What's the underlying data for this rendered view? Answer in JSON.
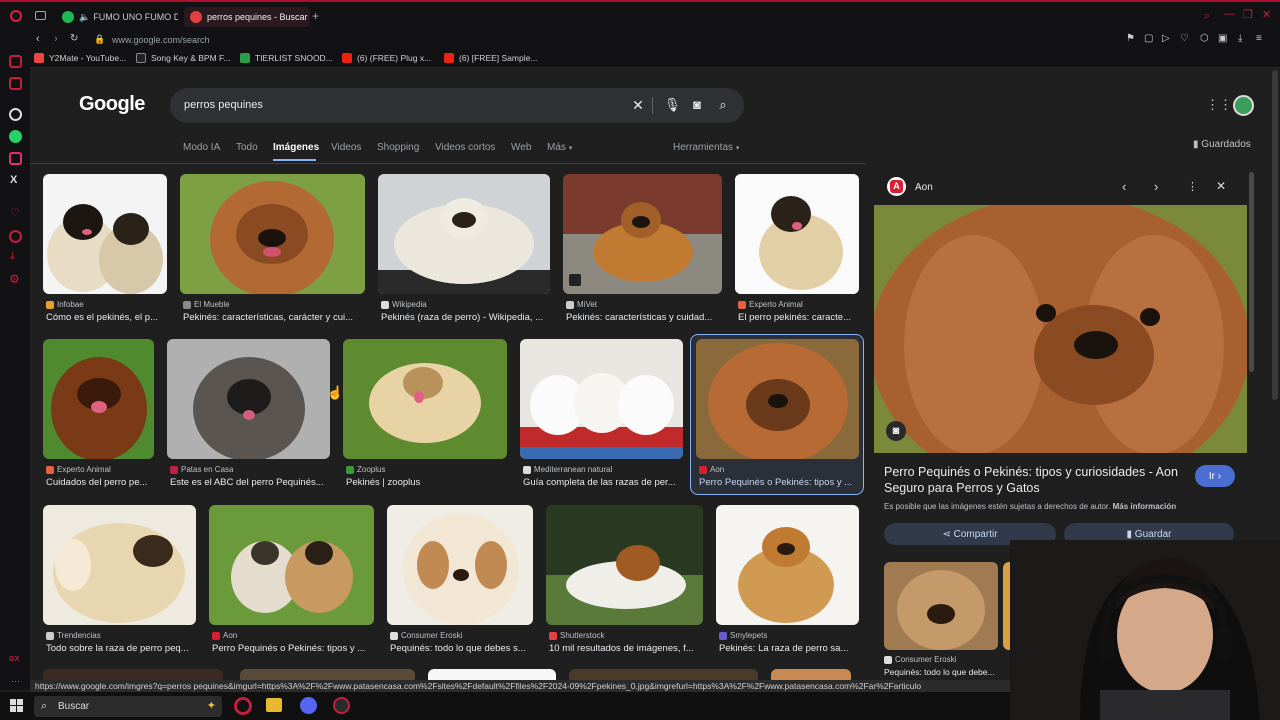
{
  "tabs": [
    {
      "label": "FUMO UNO FUMO DO"
    },
    {
      "label": "perros pequines - Buscar"
    }
  ],
  "address": {
    "url": "www.google.com/search"
  },
  "bookmarks": [
    "Y2Mate - YouTube...",
    "Song Key & BPM F...",
    "TIERLIST SNOOD...",
    "(6) (FREE) Plug x...",
    "(6) [FREE] Sample..."
  ],
  "google": {
    "logo": "Google",
    "query": "perros pequines",
    "saved": "Guardados"
  },
  "nav": [
    "Modo IA",
    "Todo",
    "Imágenes",
    "Videos",
    "Shopping",
    "Videos cortos",
    "Web",
    "Más",
    "Herramientas"
  ],
  "results_row1": [
    {
      "source": "Infobae",
      "caption": "Cómo es el pekinés, el p..."
    },
    {
      "source": "El Mueble",
      "caption": "Pekinés: características, carácter y cui..."
    },
    {
      "source": "Wikipedia",
      "caption": "Pekinés (raza de perro) - Wikipedia, ..."
    },
    {
      "source": "MiVet",
      "caption": "Pekinés: características y cuidad..."
    },
    {
      "source": "Experto Animal",
      "caption": "El perro pekinés: caracte..."
    }
  ],
  "results_row2": [
    {
      "source": "Experto Animal",
      "caption": "Cuidados del perro pe..."
    },
    {
      "source": "Patas en Casa",
      "caption": "Este es el ABC del perro Pequinés..."
    },
    {
      "source": "Zooplus",
      "caption": "Pekinés | zooplus"
    },
    {
      "source": "Mediterranean natural",
      "caption": "Guía completa de las razas de per..."
    },
    {
      "source": "Aon",
      "caption": "Perro Pequinés o Pekinés: tipos y ..."
    }
  ],
  "results_row3": [
    {
      "source": "Trendencias",
      "caption": "Todo sobre la raza de perro peq..."
    },
    {
      "source": "Aon",
      "caption": "Perro Pequinés o Pekinés: tipos y ..."
    },
    {
      "source": "Consumer Eroski",
      "caption": "Pequinés: todo lo que debes s..."
    },
    {
      "source": "Shutterstock",
      "caption": "10 mil resultados de imágenes, f..."
    },
    {
      "source": "Smylepets",
      "caption": "Pekinés: La raza de perro sa..."
    }
  ],
  "panel": {
    "source": "Aon",
    "title": "Perro Pequinés o Pekinés: tipos y curiosidades - Aon Seguro para Perros y Gatos",
    "note": "Es posible que las imágenes estén sujetas a derechos de autor.",
    "more_info": "Más información",
    "visit": "Ir",
    "share": "Compartir",
    "save": "Guardar",
    "related_source": "Consumer Eroski",
    "related_caption": "Pequinés: todo lo que debe..."
  },
  "status_url": "https://www.google.com/imgres?q=perros pequines&imgurl=https%3A%2F%2Fwww.patasencasa.com%2Fsites%2Fdefault%2Ffiles%2F2024-09%2Fpekines_0.jpg&imgrefurl=https%3A%2F%2Fwww.patasencasa.com%2Far%2Farticulo",
  "taskbar": {
    "search": "Buscar"
  },
  "colors": {
    "accent": "#8ab4f8",
    "opera_red": "#c02040",
    "background": "#1f1f1f"
  }
}
